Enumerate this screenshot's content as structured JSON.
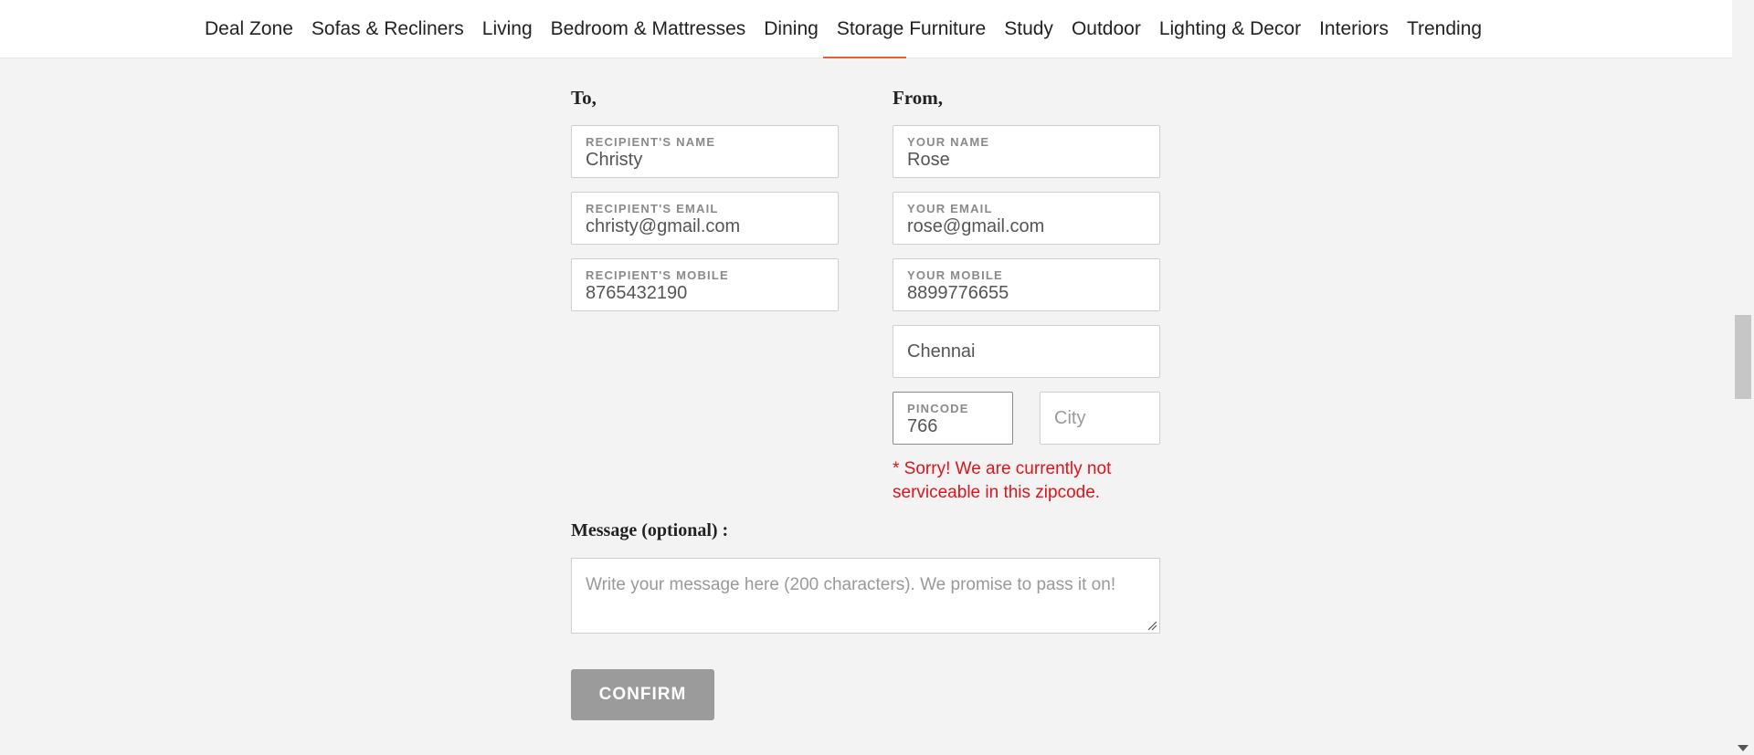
{
  "nav": {
    "items": [
      "Deal Zone",
      "Sofas & Recliners",
      "Living",
      "Bedroom & Mattresses",
      "Dining",
      "Storage Furniture",
      "Study",
      "Outdoor",
      "Lighting & Decor",
      "Interiors",
      "Trending"
    ]
  },
  "to": {
    "title": "To,",
    "recipient_name": {
      "label": "RECIPIENT'S NAME",
      "value": "Christy"
    },
    "recipient_email": {
      "label": "RECIPIENT'S EMAIL",
      "value": "christy@gmail.com"
    },
    "recipient_mobile": {
      "label": "RECIPIENT'S MOBILE",
      "value": "8765432190"
    }
  },
  "from": {
    "title": "From,",
    "your_name": {
      "label": "YOUR NAME",
      "value": "Rose"
    },
    "your_email": {
      "label": "YOUR EMAIL",
      "value": "rose@gmail.com"
    },
    "your_mobile": {
      "label": "YOUR MOBILE",
      "value": "8899776655"
    },
    "address": {
      "value": "Chennai"
    },
    "pincode": {
      "label": "PINCODE",
      "value": "766"
    },
    "city": {
      "placeholder": "City"
    },
    "error": "* Sorry! We are currently not serviceable in this zipcode."
  },
  "message": {
    "title": "Message (optional) :",
    "placeholder": "Write your message here (200 characters). We promise to pass it on!"
  },
  "confirm_label": "CONFIRM",
  "colors": {
    "accent": "#e8612c",
    "error": "#e0121c",
    "button": "#9b9b9b"
  }
}
